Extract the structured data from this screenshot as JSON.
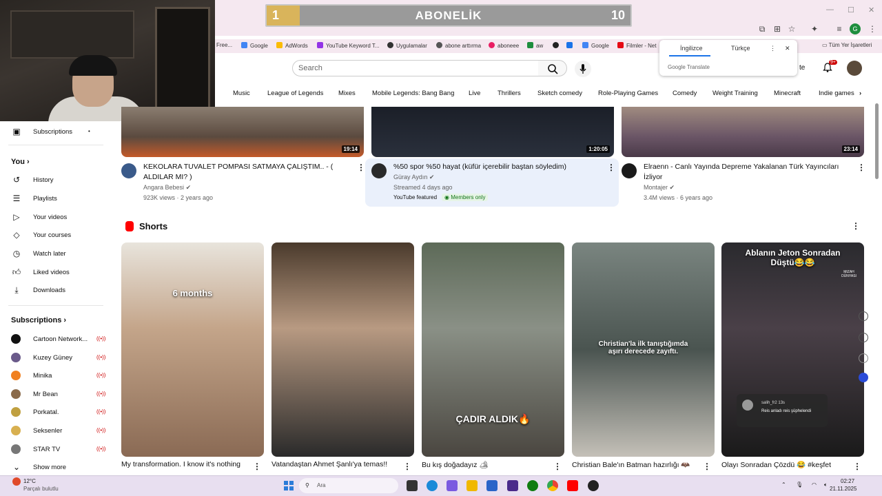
{
  "overlay": {
    "left_value": "1",
    "title": "ABONELİK",
    "right_value": "10",
    "progress": 0.09
  },
  "window": {
    "minimize": "—",
    "maximize": "☐",
    "close": "✕"
  },
  "bookmarks": [
    {
      "label": "Free..."
    },
    {
      "label": "Google",
      "color": "#4285f4"
    },
    {
      "label": "AdWords",
      "color": "#fbbc04"
    },
    {
      "label": "YouTube Keyword T...",
      "color": "#9334e6"
    },
    {
      "label": "Uygulamalar",
      "color": "#333333"
    },
    {
      "label": "abone arttırma",
      "color": "#555555"
    },
    {
      "label": "aboneee",
      "color": "#e91e63"
    },
    {
      "label": "aw",
      "color": "#1e8e3e"
    },
    {
      "label": "",
      "color": "#222222"
    },
    {
      "label": "",
      "color": "#1a73e8"
    },
    {
      "label": "Google",
      "color": "#4285f4"
    },
    {
      "label": "Filmler - Net",
      "color": "#e50914"
    }
  ],
  "bookmarks_right": "Tüm Yer İşaretleri",
  "translate": {
    "tab_source": "İngilizce",
    "tab_target": "Türkçe",
    "brand": "Google Translate",
    "more": "⋮",
    "close": "✕"
  },
  "header": {
    "search_placeholder": "Search",
    "partial_label": "te",
    "notif_badge": "9+"
  },
  "chips": [
    "Music",
    "League of Legends",
    "Mixes",
    "Mobile Legends: Bang Bang",
    "Live",
    "Thrillers",
    "Sketch comedy",
    "Role-Playing Games",
    "Comedy",
    "Weight Training",
    "Minecraft",
    "Indie games"
  ],
  "sidebar": {
    "subscriptions_top": "Subscriptions",
    "you_heading": "You",
    "you_items": [
      "History",
      "Playlists",
      "Your videos",
      "Your courses",
      "Watch later",
      "Liked videos",
      "Downloads"
    ],
    "subscriptions_heading": "Subscriptions",
    "channels": [
      {
        "name": "Cartoon Network...",
        "color": "#111111"
      },
      {
        "name": "Kuzey Güney",
        "color": "#6a5a8a"
      },
      {
        "name": "Minika",
        "color": "#f08020"
      },
      {
        "name": "Mr Bean",
        "color": "#8a6a4a"
      },
      {
        "name": "Porkatal.",
        "color": "#c0a040"
      },
      {
        "name": "Seksenler",
        "color": "#d8b050"
      },
      {
        "name": "STAR TV",
        "color": "#777777"
      }
    ],
    "show_more": "Show more",
    "live_icon": "((•))"
  },
  "videos": [
    {
      "title": "KEKOLARA TUVALET POMPASI SATMAYA ÇALIŞTIM.. - ( ALDILAR MI? )",
      "channel": "Angara Bebesi",
      "meta": "923K views · 2 years ago",
      "duration": "19:14",
      "avatar_color": "#3a5a8a"
    },
    {
      "title": "%50 spor %50 hayat (küfür içerebilir baştan söyledim)",
      "channel": "Güray Aydın",
      "meta": "Streamed 4 days ago",
      "duration": "1:20:05",
      "avatar_color": "#2a2a2a",
      "badge_featured": "YouTube featured",
      "badge_members": "Members only"
    },
    {
      "title": "Elraenn - Canlı Yayında Depreme Yakalanan Türk Yayıncıları İzliyor",
      "channel": "Montajer",
      "meta": "3.4M views · 6 years ago",
      "duration": "23:14",
      "avatar_color": "#1a1a1a"
    }
  ],
  "shorts": {
    "heading": "Shorts",
    "items": [
      {
        "title": "My transformation. I know it's nothing",
        "overlay": "6 months"
      },
      {
        "title": "Vatandaştan Ahmet Şanlı'ya temas!!",
        "overlay": ""
      },
      {
        "title": "Bu kış doğadayız 🏕",
        "overlay": "ÇADIR ALDIK🔥"
      },
      {
        "title": "Christian Bale'ın Batman hazırlığı 🦇",
        "overlay": "Christian'la ilk tanıştığımda aşırı derecede zayıftı."
      },
      {
        "title": "Olayı Sonradan Çözdü 😂 #keşfet",
        "overlay": "Ablanın Jeton Sonradan Düştü😂😂",
        "badge": "MIZAH DÜNYASI",
        "comment_user": "salih_fr2",
        "comment_time": "13s",
        "comment_text": "Reis anladı reis şüphelendi"
      }
    ]
  },
  "taskbar": {
    "weather_temp": "12°C",
    "weather_desc": "Parçalı bulutlu",
    "search_placeholder": "Ara",
    "time": "02:27",
    "date": "21.11.2025"
  }
}
